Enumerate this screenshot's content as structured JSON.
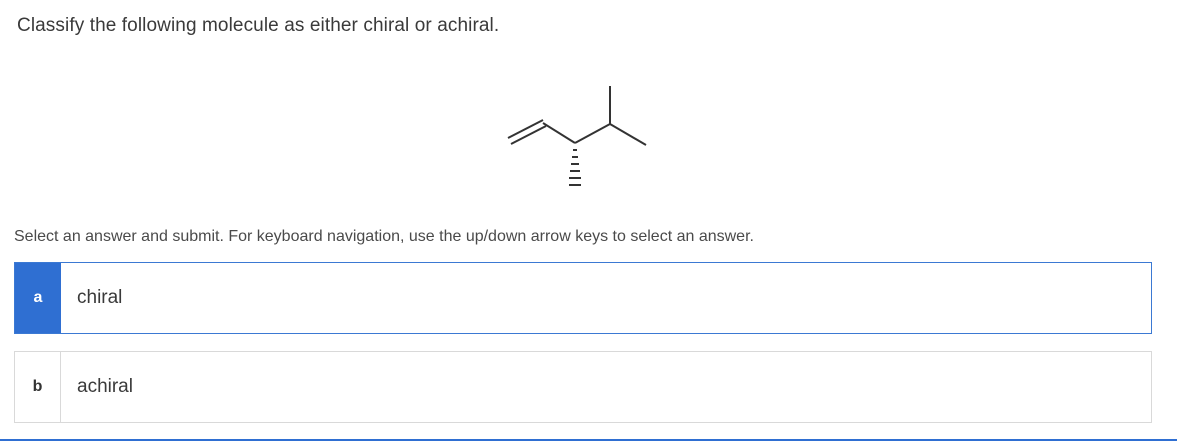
{
  "question": {
    "text": "Classify the following molecule as either chiral or achiral."
  },
  "instruction": {
    "text": "Select an answer and submit. For keyboard navigation, use the up/down arrow keys to select an answer."
  },
  "options": [
    {
      "letter": "a",
      "label": "chiral",
      "selected": true
    },
    {
      "letter": "b",
      "label": "achiral",
      "selected": false
    }
  ],
  "colors": {
    "accent": "#2f6fd2",
    "border": "#d9d9d9",
    "text": "#3a3a3a"
  }
}
